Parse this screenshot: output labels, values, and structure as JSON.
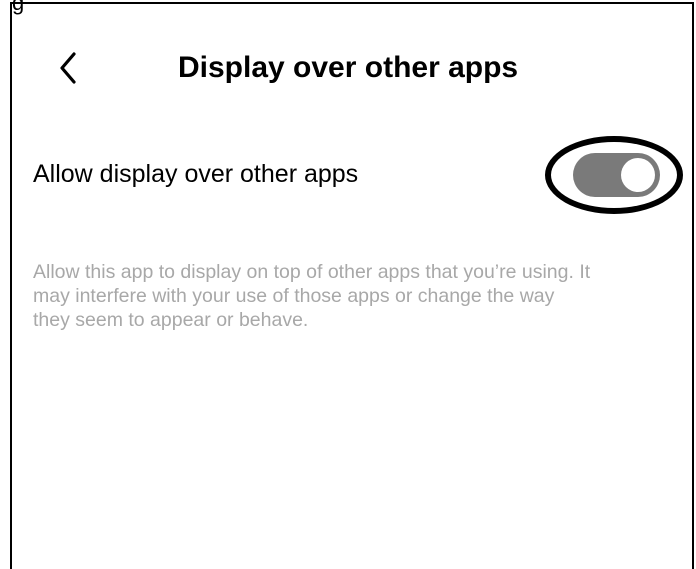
{
  "header": {
    "title": "Display over other apps",
    "back_icon": "chevron-left-icon"
  },
  "setting": {
    "label": "Allow display over other apps",
    "toggle_state": "on",
    "toggle_color": "#7a7a7a"
  },
  "description": {
    "text": "Allow this app to display on top of other apps that you’re using. It may interfere with your use of those apps or change the way they seem to appear or behave."
  },
  "overlay": {
    "top_text": "g"
  },
  "colors": {
    "background": "#ffffff",
    "text_primary": "#000000",
    "text_secondary": "#a8a8a8"
  }
}
